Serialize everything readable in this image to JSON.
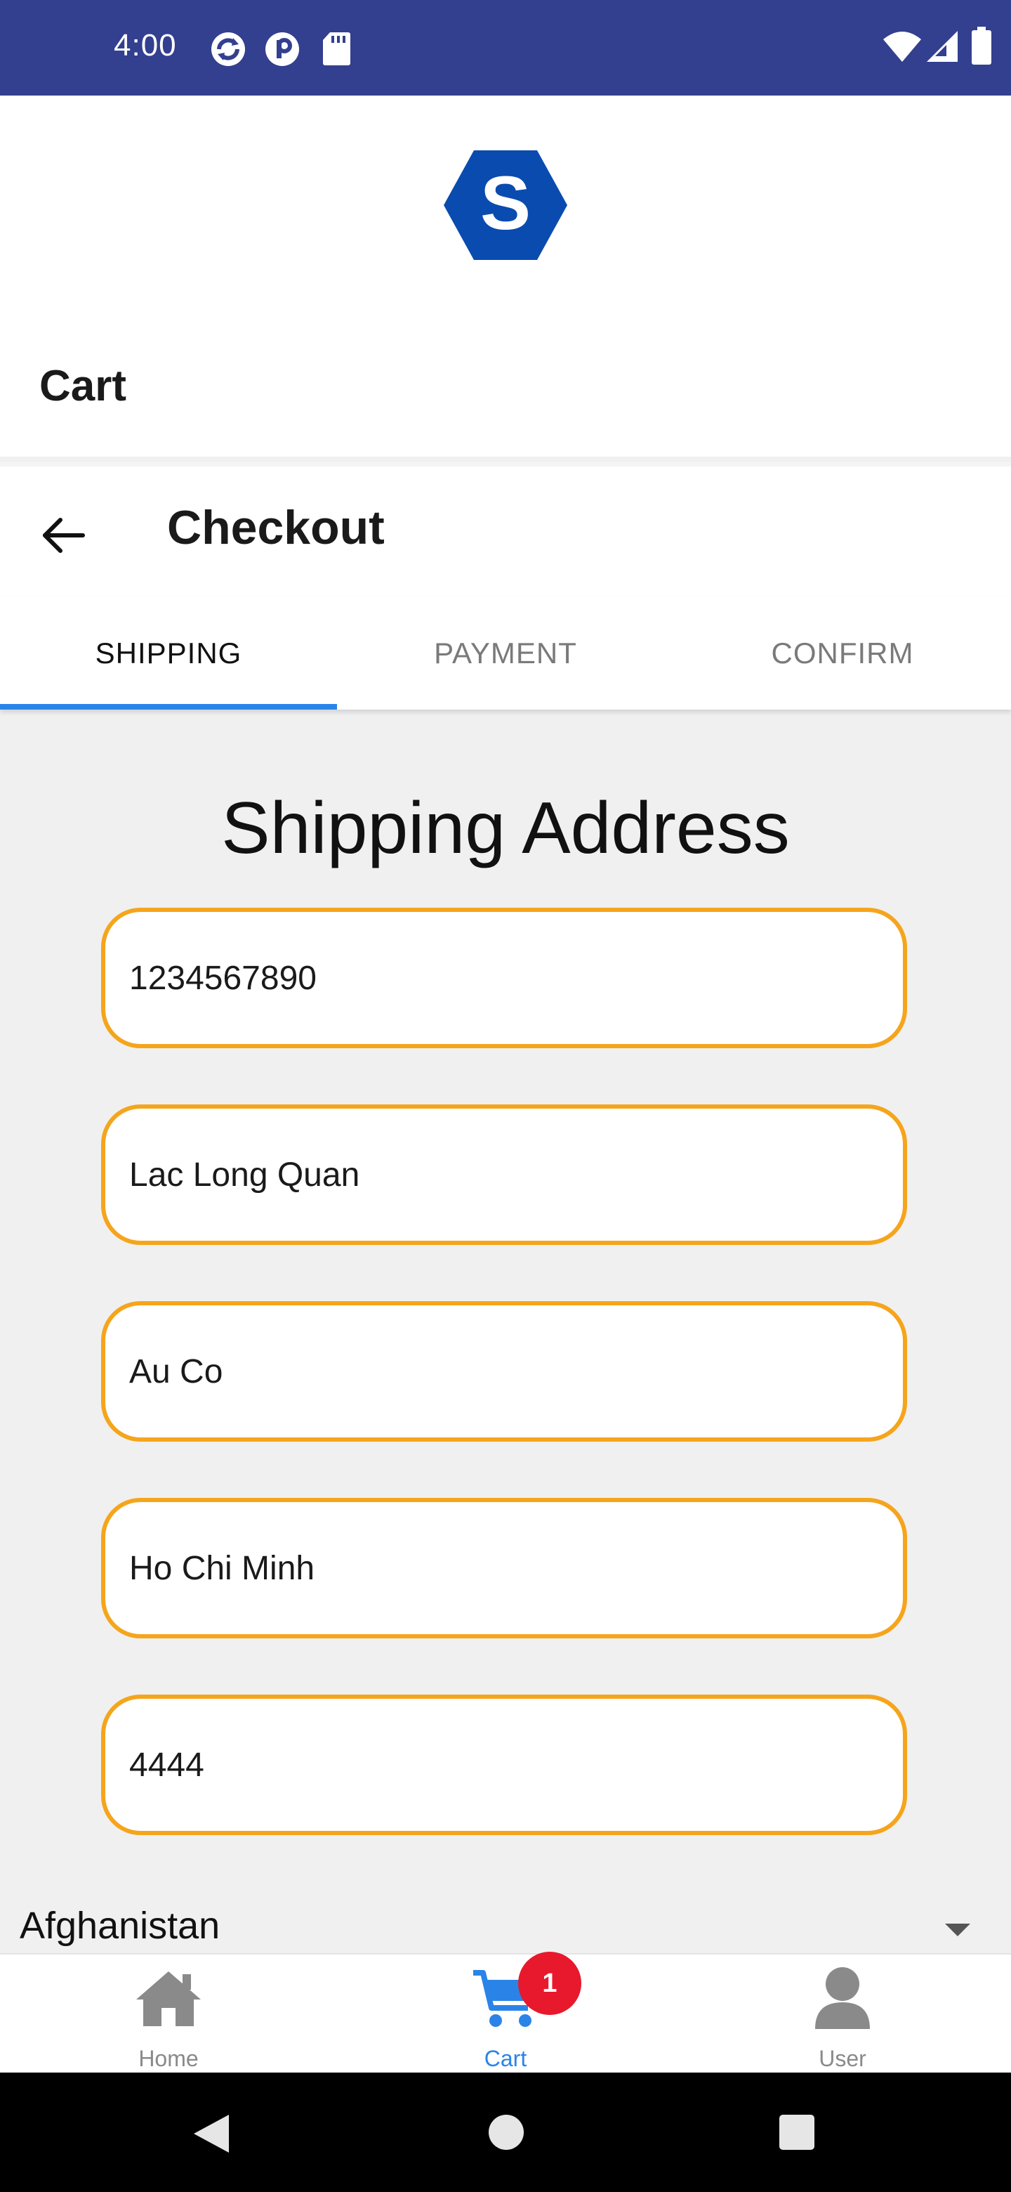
{
  "status_bar": {
    "time": "4:00",
    "background_color": "#333f8f",
    "left_icons": [
      "sync-icon",
      "p-icon",
      "sd-card-icon"
    ],
    "right_icons": [
      "wifi-icon",
      "signal-icon",
      "battery-icon"
    ]
  },
  "header": {
    "logo_letter": "S",
    "logo_color": "#0a4bb0",
    "title": "Cart"
  },
  "checkout": {
    "title": "Checkout"
  },
  "tabs": [
    {
      "label": "SHIPPING",
      "active": true
    },
    {
      "label": "PAYMENT",
      "active": false
    },
    {
      "label": "CONFIRM",
      "active": false
    }
  ],
  "form": {
    "title": "Shipping Address",
    "fields": [
      {
        "value": "1234567890"
      },
      {
        "value": "Lac Long Quan"
      },
      {
        "value": "Au Co"
      },
      {
        "value": "Ho Chi Minh"
      },
      {
        "value": "4444"
      }
    ],
    "border_color": "#f5a51c",
    "country": "Afghanistan"
  },
  "bottom_nav": {
    "items": [
      {
        "label": "Home",
        "icon": "home-icon",
        "active": false
      },
      {
        "label": "Cart",
        "icon": "cart-icon",
        "active": true
      },
      {
        "label": "User",
        "icon": "user-icon",
        "active": false
      }
    ],
    "cart_badge": "1",
    "active_color": "#2a84e8",
    "badge_color": "#e8192c"
  },
  "system_nav": {
    "buttons": [
      "back-triangle-icon",
      "home-circle-icon",
      "recents-square-icon"
    ]
  }
}
